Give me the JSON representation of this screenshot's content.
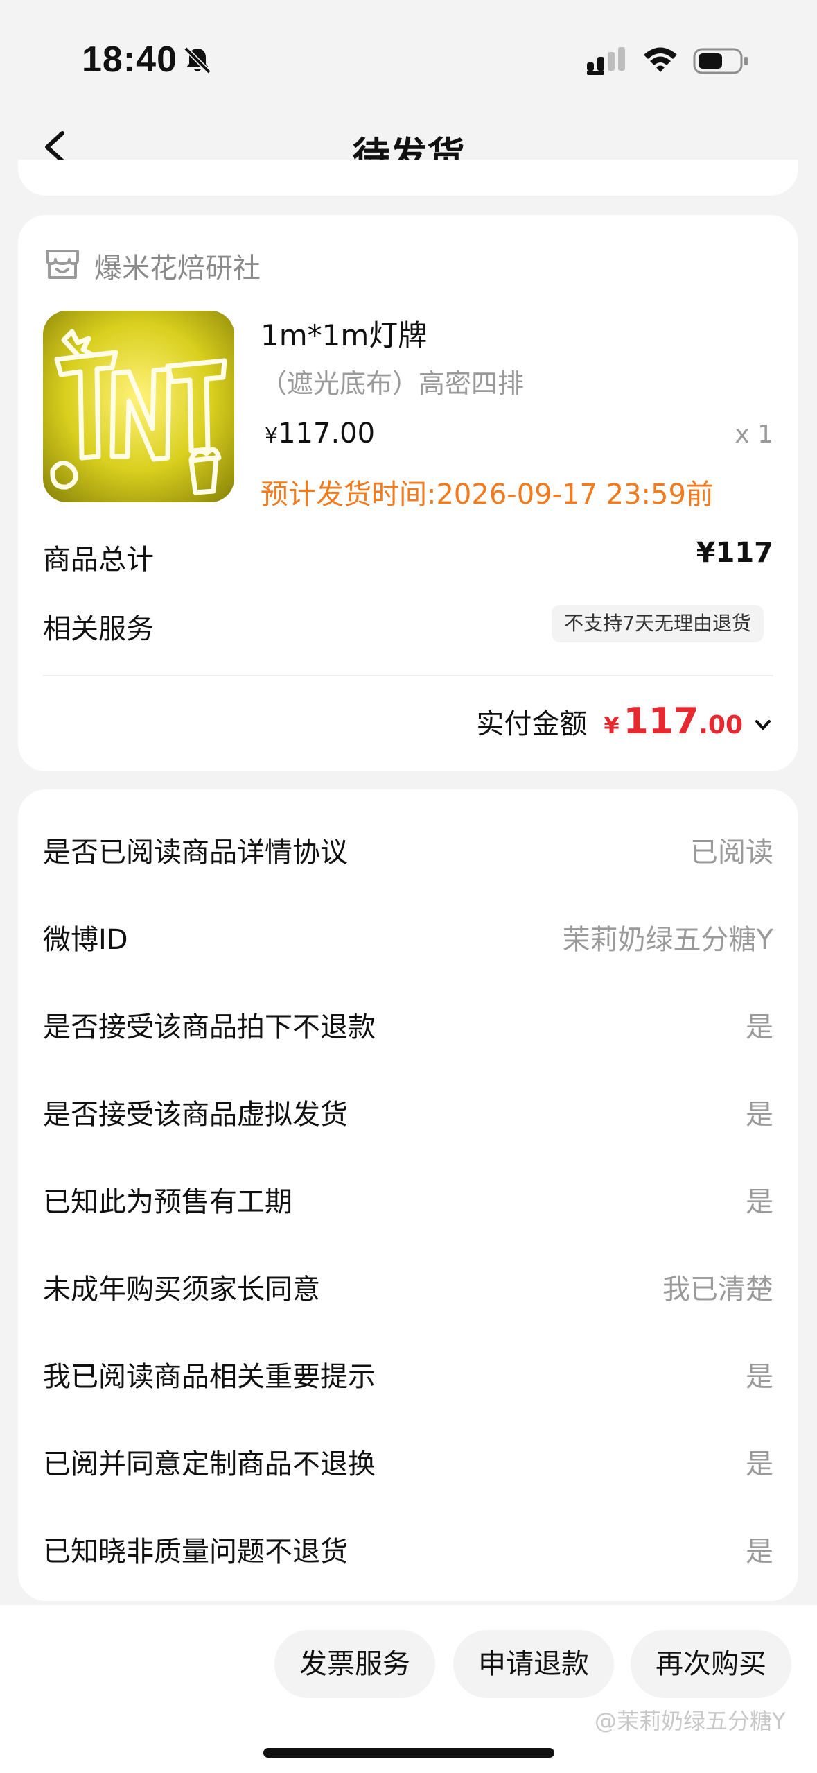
{
  "status_bar": {
    "time": "18:40"
  },
  "nav": {
    "title": "待发货"
  },
  "order": {
    "shop_name": "爆米花焙研社",
    "product": {
      "title": "1m*1m灯牌",
      "spec": "（遮光底布）高密四排",
      "price_symbol": "¥",
      "price": "117.00",
      "quantity": "x 1",
      "ship_time": "预计发货时间:2026-09-17 23:59前"
    },
    "total_label": "商品总计",
    "total_value": "¥117",
    "service_label": "相关服务",
    "service_tag": "不支持7天无理由退货",
    "paid_label": "实付金额",
    "paid_symbol": "¥",
    "paid_int": "117",
    "paid_dec": ".00"
  },
  "info": {
    "rows": [
      {
        "label": "是否已阅读商品详情协议",
        "value": "已阅读"
      },
      {
        "label": "微博ID",
        "value": "茉莉奶绿五分糖Y"
      },
      {
        "label": "是否接受该商品拍下不退款",
        "value": "是"
      },
      {
        "label": "是否接受该商品虚拟发货",
        "value": "是"
      },
      {
        "label": "已知此为预售有工期",
        "value": "是"
      },
      {
        "label": "未成年购买须家长同意",
        "value": "我已清楚"
      },
      {
        "label": "我已阅读商品相关重要提示",
        "value": "是"
      },
      {
        "label": "已阅并同意定制商品不退换",
        "value": "是"
      },
      {
        "label": "已知晓非质量问题不退货",
        "value": "是"
      }
    ]
  },
  "actions": {
    "invoice": "发票服务",
    "refund": "申请退款",
    "rebuy": "再次购买"
  },
  "watermark": "@茉莉奶绿五分糖Y",
  "colors": {
    "accent_red": "#e8282f",
    "ship_orange": "#f37b1d",
    "background": "#f3f3f3"
  }
}
